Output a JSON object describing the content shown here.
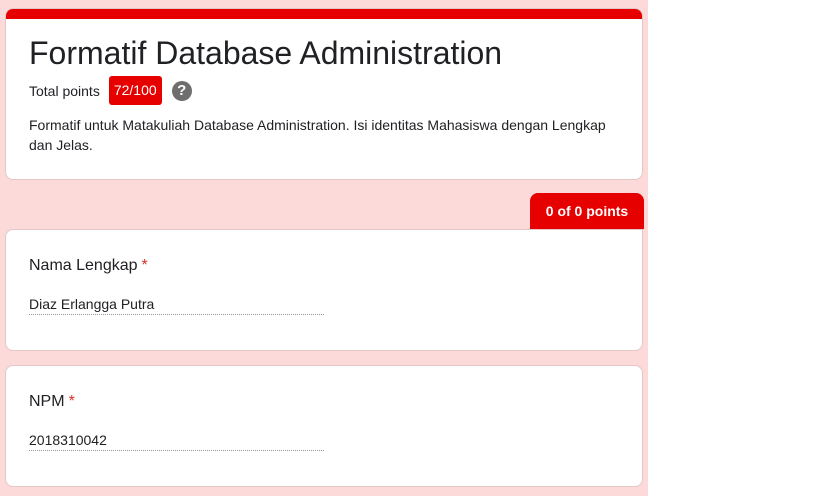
{
  "form": {
    "title": "Formatif Database Administration",
    "total_points_label": "Total points",
    "score": "72/100",
    "help_icon": "?",
    "description": "Formatif untuk Matakuliah Database Administration. Isi identitas Mahasiswa dengan Lengkap dan Jelas.",
    "accent_color": "#e60000",
    "background_color": "#fddada"
  },
  "section": {
    "points": "0 of 0 points"
  },
  "questions": [
    {
      "title": "Nama Lengkap",
      "required_mark": "*",
      "answer": "Diaz Erlangga Putra"
    },
    {
      "title": "NPM",
      "required_mark": "*",
      "answer": "2018310042"
    }
  ]
}
